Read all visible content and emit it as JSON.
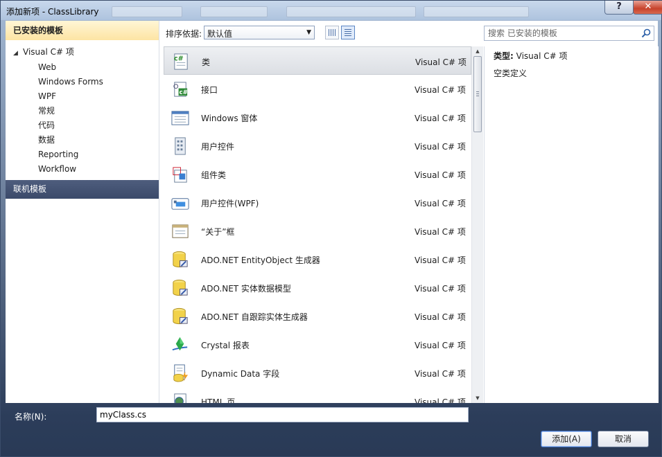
{
  "window": {
    "title": "添加新项 - ClassLibrary",
    "help_label": "?",
    "close_label": "✕"
  },
  "left": {
    "installed_header": "已安装的模板",
    "root_label": "Visual C# 项",
    "children": [
      "Web",
      "Windows Forms",
      "WPF",
      "常规",
      "代码",
      "数据",
      "Reporting",
      "Workflow"
    ],
    "online_header": "联机模板"
  },
  "toolbar": {
    "sort_label": "排序依据:",
    "sort_value": "默认值",
    "search_placeholder": "搜索 已安装的模板"
  },
  "templates": [
    {
      "name": "类",
      "type": "Visual C# 项",
      "icon": "class-icon"
    },
    {
      "name": "接口",
      "type": "Visual C# 项",
      "icon": "interface-icon"
    },
    {
      "name": "Windows 窗体",
      "type": "Visual C# 项",
      "icon": "windows-form-icon"
    },
    {
      "name": "用户控件",
      "type": "Visual C# 项",
      "icon": "user-control-icon"
    },
    {
      "name": "组件类",
      "type": "Visual C# 项",
      "icon": "component-class-icon"
    },
    {
      "name": "用户控件(WPF)",
      "type": "Visual C# 项",
      "icon": "wpf-user-control-icon"
    },
    {
      "name": "“关于”框",
      "type": "Visual C# 项",
      "icon": "about-box-icon"
    },
    {
      "name": "ADO.NET EntityObject 生成器",
      "type": "Visual C# 项",
      "icon": "database-icon"
    },
    {
      "name": "ADO.NET 实体数据模型",
      "type": "Visual C# 项",
      "icon": "database-icon"
    },
    {
      "name": "ADO.NET 自跟踪实体生成器",
      "type": "Visual C# 项",
      "icon": "database-icon"
    },
    {
      "name": "Crystal 报表",
      "type": "Visual C# 项",
      "icon": "crystal-report-icon"
    },
    {
      "name": "Dynamic Data 字段",
      "type": "Visual C# 项",
      "icon": "dynamic-data-icon"
    },
    {
      "name": "HTML 页",
      "type": "Visual C# 项",
      "icon": "html-page-icon"
    }
  ],
  "details": {
    "type_label": "类型:",
    "type_value": "Visual C# 项",
    "description": "空类定义"
  },
  "bottom": {
    "name_label": "名称(N):",
    "name_value": "myClass.cs",
    "add_label": "添加(A)",
    "cancel_label": "取消"
  },
  "colors": {
    "online_header_bg": "#3b4a6a",
    "installed_header_bg": "#fde4a3",
    "selection": "#dcdfe4"
  }
}
